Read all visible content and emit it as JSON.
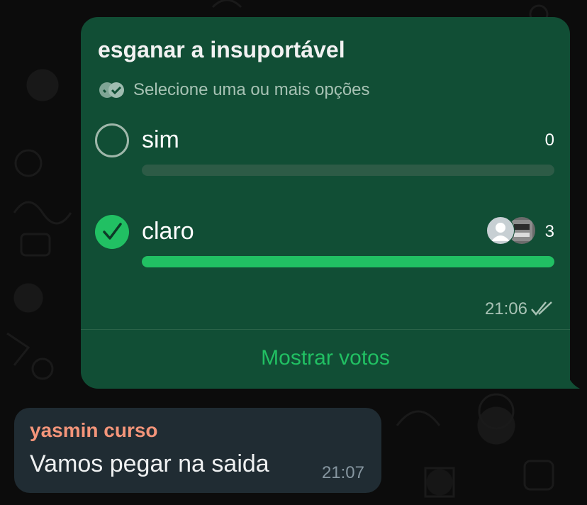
{
  "poll": {
    "title": "esganar a insuportável",
    "hint": "Selecione uma ou mais opções",
    "options": [
      {
        "label": "sim",
        "votes": "0",
        "fraction": 0,
        "selected": false
      },
      {
        "label": "claro",
        "votes": "3",
        "fraction": 1,
        "selected": true
      }
    ],
    "time": "21:06",
    "show_votes_label": "Mostrar votos"
  },
  "message": {
    "sender": "yasmin curso",
    "text": "Vamos pegar na saida",
    "time": "21:07"
  },
  "colors": {
    "poll_bubble": "#114e35",
    "accent_green": "#21c063",
    "incoming_bubble": "#202c33",
    "sender_name": "#f4957a"
  },
  "icons": [
    "double-check-circle-icon",
    "radio-empty-icon",
    "check-icon",
    "double-check-icon"
  ]
}
